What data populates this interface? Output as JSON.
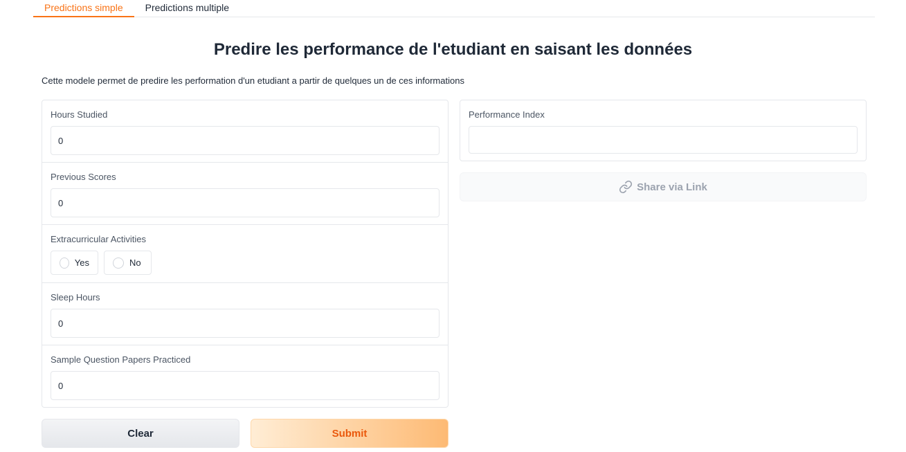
{
  "tabs": [
    {
      "label": "Predictions simple",
      "active": true
    },
    {
      "label": "Predictions multiple",
      "active": false
    }
  ],
  "title": "Predire les performance de l'etudiant en saisant les données",
  "description": "Cette modele permet de predire les performation d'un etudiant a partir de quelques un de ces informations",
  "inputs": {
    "hours_studied": {
      "label": "Hours Studied",
      "value": "0"
    },
    "previous_scores": {
      "label": "Previous Scores",
      "value": "0"
    },
    "extracurricular": {
      "label": "Extracurricular Activities",
      "options": [
        "Yes",
        "No"
      ]
    },
    "sleep_hours": {
      "label": "Sleep Hours",
      "value": "0"
    },
    "sample_papers": {
      "label": "Sample Question Papers Practiced",
      "value": "0"
    }
  },
  "buttons": {
    "clear": "Clear",
    "submit": "Submit"
  },
  "output": {
    "label": "Performance Index",
    "value": ""
  },
  "share": {
    "label": "Share via Link",
    "icon": "link-icon"
  },
  "colors": {
    "accent": "#f97316",
    "submit_text": "#ea580c"
  }
}
